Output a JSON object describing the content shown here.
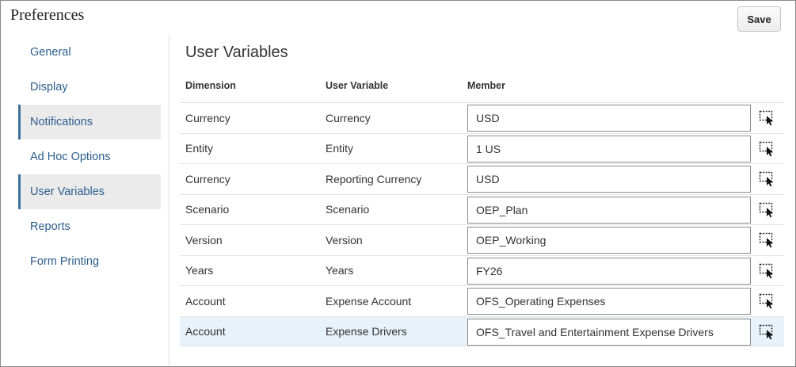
{
  "header": {
    "title": "Preferences",
    "save_label": "Save"
  },
  "sidebar": {
    "items": [
      {
        "label": "General",
        "active": false
      },
      {
        "label": "Display",
        "active": false
      },
      {
        "label": "Notifications",
        "active": true
      },
      {
        "label": "Ad Hoc Options",
        "active": false
      },
      {
        "label": "User Variables",
        "active": true
      },
      {
        "label": "Reports",
        "active": false
      },
      {
        "label": "Form Printing",
        "active": false
      }
    ]
  },
  "main": {
    "title": "User Variables",
    "columns": {
      "dimension": "Dimension",
      "variable": "User Variable",
      "member": "Member"
    },
    "rows": [
      {
        "dimension": "Currency",
        "variable": "Currency",
        "member": "USD",
        "selected": false
      },
      {
        "dimension": "Entity",
        "variable": "Entity",
        "member": "1 US",
        "selected": false
      },
      {
        "dimension": "Currency",
        "variable": "Reporting Currency",
        "member": "USD",
        "selected": false
      },
      {
        "dimension": "Scenario",
        "variable": "Scenario",
        "member": "OEP_Plan",
        "selected": false
      },
      {
        "dimension": "Version",
        "variable": "Version",
        "member": "OEP_Working",
        "selected": false
      },
      {
        "dimension": "Years",
        "variable": "Years",
        "member": "FY26",
        "selected": false
      },
      {
        "dimension": "Account",
        "variable": "Expense Account",
        "member": "OFS_Operating Expenses",
        "selected": false
      },
      {
        "dimension": "Account",
        "variable": "Expense Drivers",
        "member": "OFS_Travel and Entertainment Expense Drivers",
        "selected": true
      }
    ],
    "selector_icon": "member-selector-icon"
  },
  "colors": {
    "link": "#2b5d8c",
    "active_bar": "#3c6f9c",
    "active_bg": "#ebebeb",
    "selected_row": "#e7f2fa"
  }
}
